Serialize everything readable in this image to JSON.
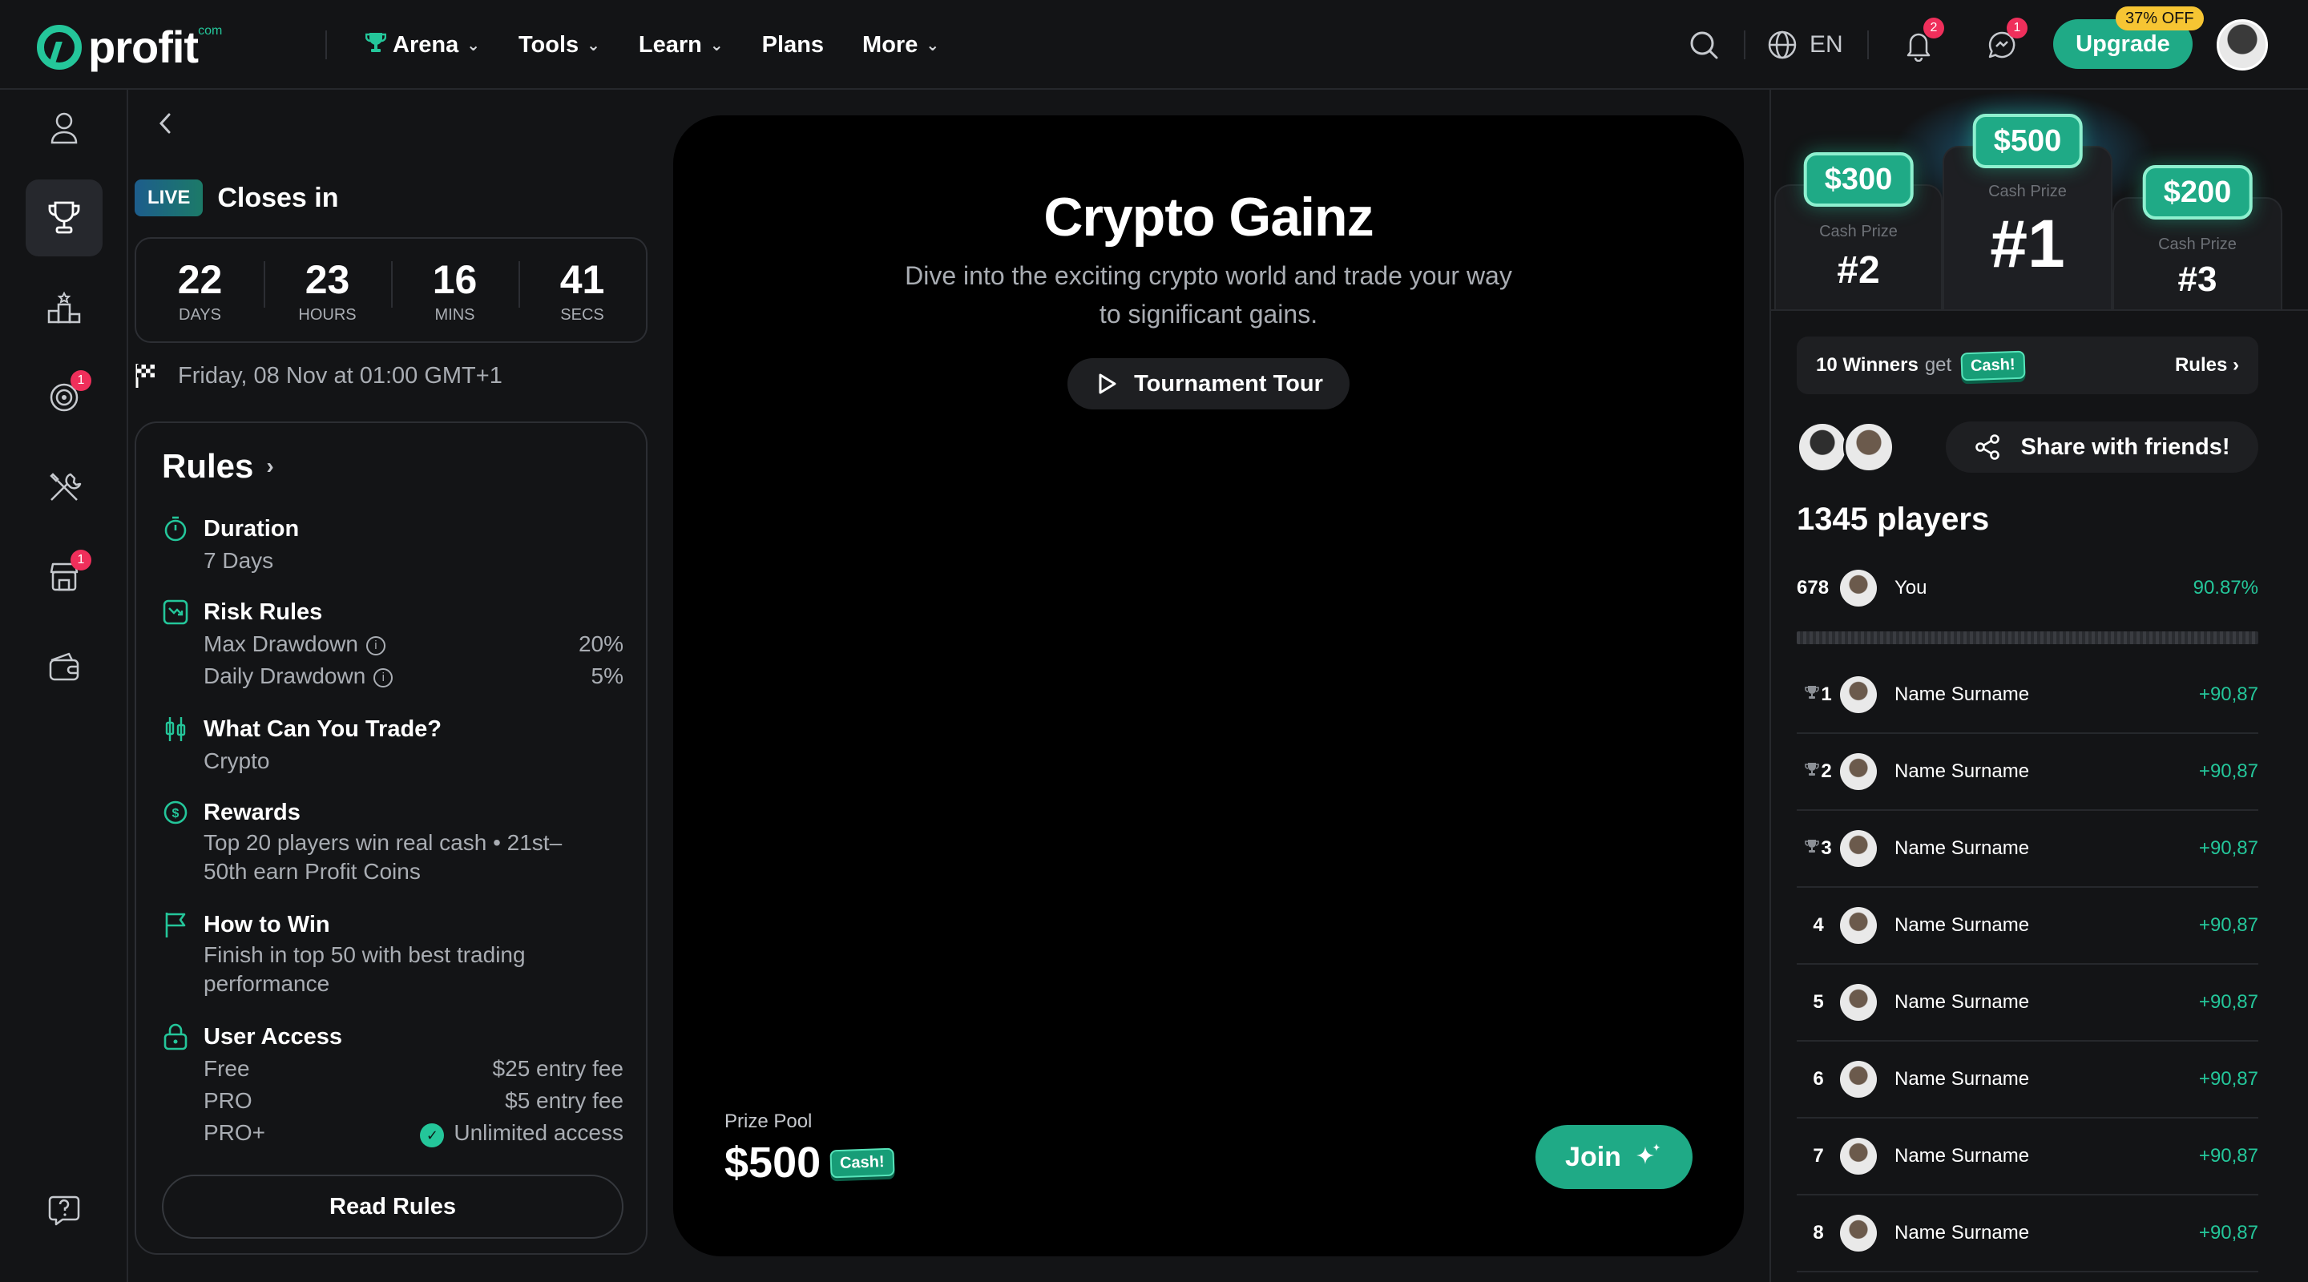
{
  "brand": {
    "name": "profit",
    "suffix": "com"
  },
  "nav": [
    {
      "label": "Arena",
      "has_menu": true,
      "icon": "trophy-icon"
    },
    {
      "label": "Tools",
      "has_menu": true
    },
    {
      "label": "Learn",
      "has_menu": true
    },
    {
      "label": "Plans",
      "has_menu": false
    },
    {
      "label": "More",
      "has_menu": true
    }
  ],
  "topbar": {
    "language": "EN",
    "notifications_count": "2",
    "messages_count": "1",
    "upgrade_label": "Upgrade",
    "discount_label": "37% OFF"
  },
  "sidebar": {
    "items": [
      {
        "icon": "user-icon",
        "active": false
      },
      {
        "icon": "trophy-icon",
        "active": true
      },
      {
        "icon": "podium-icon",
        "active": false
      },
      {
        "icon": "target-icon",
        "active": false,
        "badge": "1"
      },
      {
        "icon": "tools-icon",
        "active": false
      },
      {
        "icon": "store-icon",
        "active": false,
        "badge": "1"
      },
      {
        "icon": "wallet-icon",
        "active": false
      },
      {
        "icon": "help-icon",
        "active": false
      }
    ]
  },
  "tournament": {
    "live_label": "LIVE",
    "closes_label": "Closes in",
    "countdown": [
      {
        "value": "22",
        "unit": "DAYS"
      },
      {
        "value": "23",
        "unit": "HOURS"
      },
      {
        "value": "16",
        "unit": "MINS"
      },
      {
        "value": "41",
        "unit": "SECS"
      }
    ],
    "end_date": "Friday, 08 Nov at 01:00 GMT+1",
    "title": "Crypto Gainz",
    "description": "Dive into the exciting crypto world and trade your way to significant gains.",
    "tour_label": "Tournament Tour",
    "prize_pool_label": "Prize Pool",
    "prize_pool_value": "$500",
    "cash_label": "Cash!",
    "join_label": "Join"
  },
  "rules": {
    "title": "Rules",
    "duration": {
      "title": "Duration",
      "value": "7 Days"
    },
    "risk": {
      "title": "Risk Rules",
      "max_label": "Max Drawdown",
      "max_value": "20%",
      "daily_label": "Daily Drawdown",
      "daily_value": "5%"
    },
    "trade": {
      "title": "What Can You Trade?",
      "value": "Crypto"
    },
    "rewards": {
      "title": "Rewards",
      "value": "Top 20 players win real cash • 21st–50th earn Profit Coins"
    },
    "how": {
      "title": "How to Win",
      "value": "Finish in top 50 with best trading performance"
    },
    "access": {
      "title": "User Access",
      "rows": [
        {
          "tier": "Free",
          "value": "$25 entry fee"
        },
        {
          "tier": "PRO",
          "value": "$5 entry fee"
        },
        {
          "tier": "PRO+",
          "value": "Unlimited access"
        }
      ]
    },
    "read_label": "Read Rules"
  },
  "prizes": [
    {
      "amount": "$300",
      "label": "Cash Prize",
      "rank": "#2"
    },
    {
      "amount": "$500",
      "label": "Cash Prize",
      "rank": "#1"
    },
    {
      "amount": "$200",
      "label": "Cash Prize",
      "rank": "#3"
    }
  ],
  "winners": {
    "count_label": "10 Winners",
    "get_label": "get",
    "cash_label": "Cash!",
    "rules_label": "Rules"
  },
  "share_label": "Share with friends!",
  "players_label": "1345 players",
  "you": {
    "rank": "678",
    "name": "You",
    "score": "90.87%"
  },
  "leaderboard": [
    {
      "rank": "1",
      "name": "Name Surname",
      "score": "+90,87",
      "cup": true
    },
    {
      "rank": "2",
      "name": "Name Surname",
      "score": "+90,87",
      "cup": true
    },
    {
      "rank": "3",
      "name": "Name Surname",
      "score": "+90,87",
      "cup": true
    },
    {
      "rank": "4",
      "name": "Name Surname",
      "score": "+90,87",
      "cup": false
    },
    {
      "rank": "5",
      "name": "Name Surname",
      "score": "+90,87",
      "cup": false
    },
    {
      "rank": "6",
      "name": "Name Surname",
      "score": "+90,87",
      "cup": false
    },
    {
      "rank": "7",
      "name": "Name Surname",
      "score": "+90,87",
      "cup": false
    },
    {
      "rank": "8",
      "name": "Name Surname",
      "score": "+90,87",
      "cup": false
    }
  ],
  "colors": {
    "accent": "#1faa86",
    "accent_light": "#24c69a",
    "alert": "#ef2f5b",
    "discount": "#f6c533",
    "background": "#131416"
  }
}
